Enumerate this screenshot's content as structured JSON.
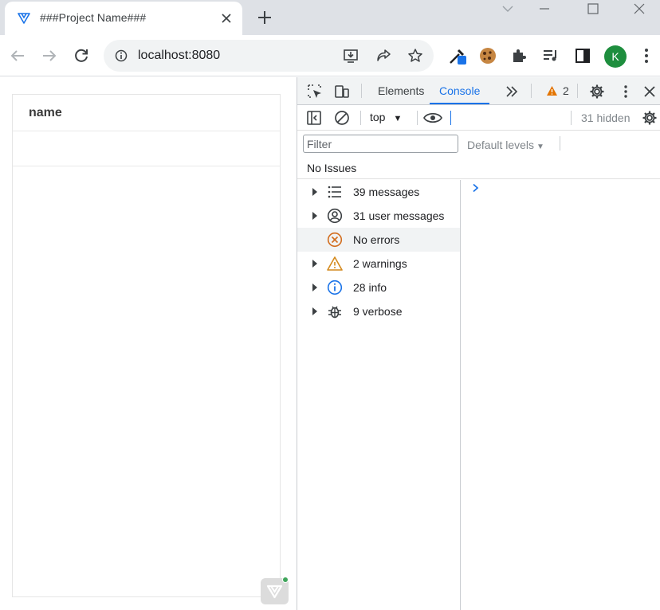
{
  "browser": {
    "tab": {
      "title": "###Project Name###"
    },
    "address": {
      "url": "localhost:8080"
    },
    "profile": {
      "initial": "K"
    }
  },
  "page": {
    "table": {
      "columns": [
        "name"
      ]
    }
  },
  "devtools": {
    "tabs": [
      {
        "label": "Elements",
        "active": false
      },
      {
        "label": "Console",
        "active": true
      }
    ],
    "warning_count": "2",
    "context": "top",
    "hidden": "31 hidden",
    "filter_placeholder": "Filter",
    "levels": "Default levels",
    "issues": "No Issues",
    "sidebar": [
      {
        "label": "39 messages",
        "icon": "list-icon",
        "expandable": true,
        "selected": false
      },
      {
        "label": "31 user messages",
        "icon": "user-icon",
        "expandable": true,
        "selected": false
      },
      {
        "label": "No errors",
        "icon": "error-icon",
        "expandable": false,
        "selected": true
      },
      {
        "label": "2 warnings",
        "icon": "warning-icon",
        "expandable": true,
        "selected": false
      },
      {
        "label": "28 info",
        "icon": "info-icon",
        "expandable": true,
        "selected": false
      },
      {
        "label": "9 verbose",
        "icon": "bug-icon",
        "expandable": true,
        "selected": false
      }
    ]
  },
  "colors": {
    "accent": "#1a73e8",
    "warning": "#e37400",
    "error": "#c5221f",
    "avatar": "#1e8e3e"
  }
}
